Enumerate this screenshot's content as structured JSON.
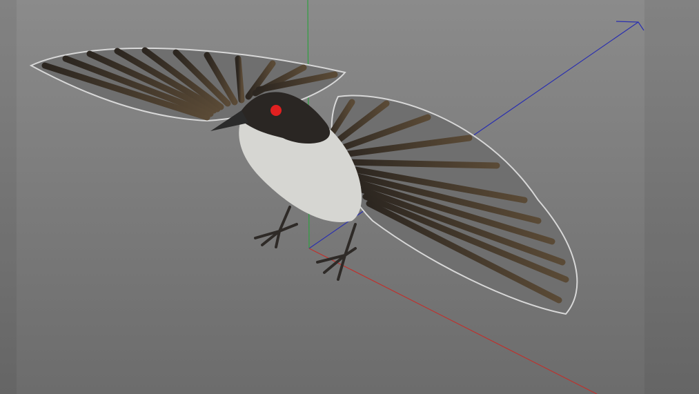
{
  "viewport": {
    "colors": {
      "axis_x": "#c0302c",
      "axis_y": "#2fa040",
      "axis_z": "#2a2fb0",
      "feather": "#3d3428",
      "selection_outline": "#d8d8d8",
      "cheek": "#e02020"
    },
    "icons": [
      "axis-gizmo-icon"
    ]
  }
}
